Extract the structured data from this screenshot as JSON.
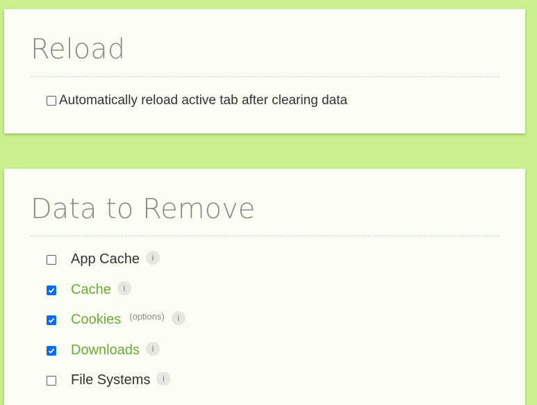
{
  "reload_section": {
    "title": "Reload",
    "option_label": "Automatically reload active tab after clearing data",
    "option_checked": false
  },
  "data_section": {
    "title": "Data to Remove",
    "items": [
      {
        "label": "App Cache",
        "checked": false,
        "info": "i"
      },
      {
        "label": "Cache",
        "checked": true,
        "info": "i"
      },
      {
        "label": "Cookies",
        "checked": true,
        "options_label": "(options)",
        "info": "i"
      },
      {
        "label": "Downloads",
        "checked": true,
        "info": "i"
      },
      {
        "label": "File Systems",
        "checked": false,
        "info": "i"
      }
    ]
  },
  "colors": {
    "page_background": "#c9f08c",
    "card_background": "#f9fdf4",
    "checked_label": "#6dab35",
    "checkbox_checked": "#0a6cf0"
  }
}
